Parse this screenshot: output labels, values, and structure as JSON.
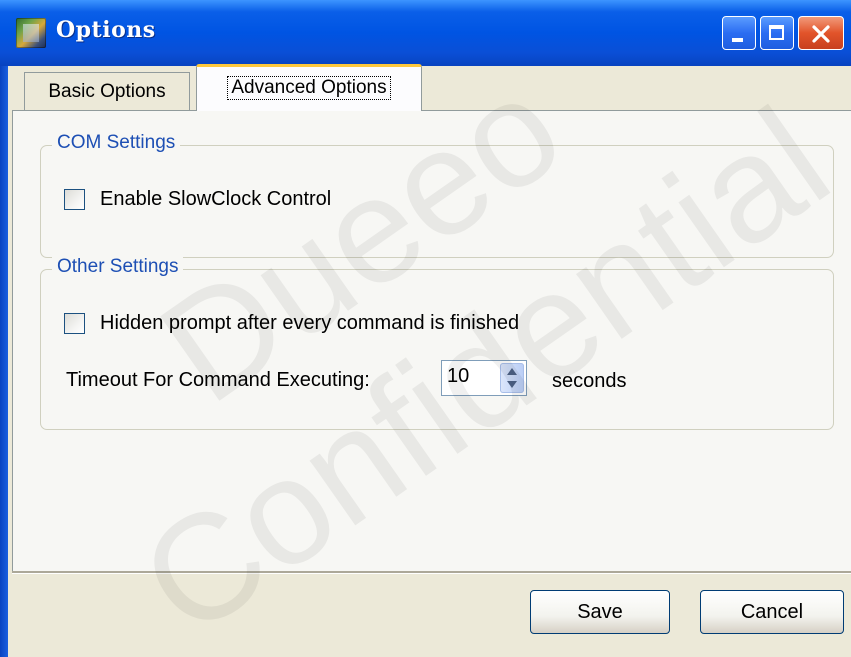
{
  "window": {
    "title": "Options",
    "title_bar_color": "#0054e3"
  },
  "tabs": [
    {
      "label": "Basic Options",
      "active": false
    },
    {
      "label": "Advanced Options",
      "active": true
    }
  ],
  "com_settings": {
    "legend": "COM Settings",
    "enable_slowclock": {
      "label": "Enable SlowClock Control",
      "checked": false
    }
  },
  "other_settings": {
    "legend": "Other Settings",
    "hidden_prompt": {
      "label": "Hidden prompt after every command is finished",
      "checked": false
    },
    "timeout": {
      "label": "Timeout For Command Executing:",
      "value": "10",
      "unit": "seconds"
    }
  },
  "buttons": {
    "save": "Save",
    "cancel": "Cancel"
  },
  "watermark": {
    "line1": "Dueeo",
    "line2": "Confidential",
    "color": "#e6e6e6"
  },
  "icons": {
    "app": "options-app-icon",
    "minimize": "minimize-icon",
    "maximize": "maximize-icon",
    "close": "close-icon"
  },
  "colors": {
    "dialog_bg": "#ece9d8",
    "legend_text": "#1d4fb4",
    "active_tab_accent": "#ffc83c"
  }
}
